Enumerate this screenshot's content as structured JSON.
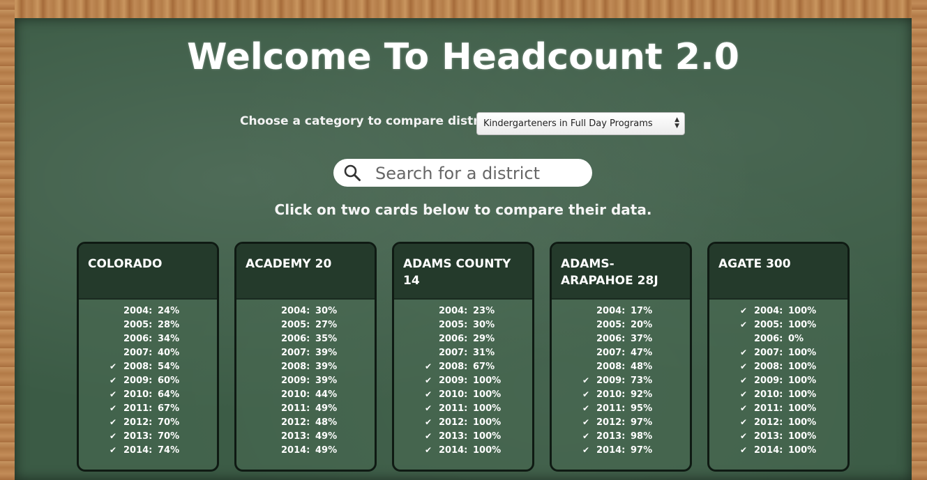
{
  "title": "Welcome To Headcount 2.0",
  "category": {
    "label": "Choose a category to compare districts:",
    "selected": "Kindergarteners in Full Day Programs"
  },
  "search": {
    "placeholder": "Search for a district",
    "icon": "search-icon"
  },
  "instruction": "Click on two cards below to compare their data.",
  "cards": [
    {
      "name": "COLORADO",
      "rows": [
        {
          "year": "2004:",
          "value": "24%",
          "check": false
        },
        {
          "year": "2005:",
          "value": "28%",
          "check": false
        },
        {
          "year": "2006:",
          "value": "34%",
          "check": false
        },
        {
          "year": "2007:",
          "value": "40%",
          "check": false
        },
        {
          "year": "2008:",
          "value": "54%",
          "check": true
        },
        {
          "year": "2009:",
          "value": "60%",
          "check": true
        },
        {
          "year": "2010:",
          "value": "64%",
          "check": true
        },
        {
          "year": "2011:",
          "value": "67%",
          "check": true
        },
        {
          "year": "2012:",
          "value": "70%",
          "check": true
        },
        {
          "year": "2013:",
          "value": "70%",
          "check": true
        },
        {
          "year": "2014:",
          "value": "74%",
          "check": true
        }
      ]
    },
    {
      "name": "ACADEMY 20",
      "rows": [
        {
          "year": "2004:",
          "value": "30%",
          "check": false
        },
        {
          "year": "2005:",
          "value": "27%",
          "check": false
        },
        {
          "year": "2006:",
          "value": "35%",
          "check": false
        },
        {
          "year": "2007:",
          "value": "39%",
          "check": false
        },
        {
          "year": "2008:",
          "value": "39%",
          "check": false
        },
        {
          "year": "2009:",
          "value": "39%",
          "check": false
        },
        {
          "year": "2010:",
          "value": "44%",
          "check": false
        },
        {
          "year": "2011:",
          "value": "49%",
          "check": false
        },
        {
          "year": "2012:",
          "value": "48%",
          "check": false
        },
        {
          "year": "2013:",
          "value": "49%",
          "check": false
        },
        {
          "year": "2014:",
          "value": "49%",
          "check": false
        }
      ]
    },
    {
      "name": "ADAMS COUNTY 14",
      "rows": [
        {
          "year": "2004:",
          "value": "23%",
          "check": false
        },
        {
          "year": "2005:",
          "value": "30%",
          "check": false
        },
        {
          "year": "2006:",
          "value": "29%",
          "check": false
        },
        {
          "year": "2007:",
          "value": "31%",
          "check": false
        },
        {
          "year": "2008:",
          "value": "67%",
          "check": true
        },
        {
          "year": "2009:",
          "value": "100%",
          "check": true
        },
        {
          "year": "2010:",
          "value": "100%",
          "check": true
        },
        {
          "year": "2011:",
          "value": "100%",
          "check": true
        },
        {
          "year": "2012:",
          "value": "100%",
          "check": true
        },
        {
          "year": "2013:",
          "value": "100%",
          "check": true
        },
        {
          "year": "2014:",
          "value": "100%",
          "check": true
        }
      ]
    },
    {
      "name": "ADAMS-ARAPAHOE 28J",
      "rows": [
        {
          "year": "2004:",
          "value": "17%",
          "check": false
        },
        {
          "year": "2005:",
          "value": "20%",
          "check": false
        },
        {
          "year": "2006:",
          "value": "37%",
          "check": false
        },
        {
          "year": "2007:",
          "value": "47%",
          "check": false
        },
        {
          "year": "2008:",
          "value": "48%",
          "check": false
        },
        {
          "year": "2009:",
          "value": "73%",
          "check": true
        },
        {
          "year": "2010:",
          "value": "92%",
          "check": true
        },
        {
          "year": "2011:",
          "value": "95%",
          "check": true
        },
        {
          "year": "2012:",
          "value": "97%",
          "check": true
        },
        {
          "year": "2013:",
          "value": "98%",
          "check": true
        },
        {
          "year": "2014:",
          "value": "97%",
          "check": true
        }
      ]
    },
    {
      "name": "AGATE 300",
      "rows": [
        {
          "year": "2004:",
          "value": "100%",
          "check": true
        },
        {
          "year": "2005:",
          "value": "100%",
          "check": true
        },
        {
          "year": "2006:",
          "value": "0%",
          "check": false
        },
        {
          "year": "2007:",
          "value": "100%",
          "check": true
        },
        {
          "year": "2008:",
          "value": "100%",
          "check": true
        },
        {
          "year": "2009:",
          "value": "100%",
          "check": true
        },
        {
          "year": "2010:",
          "value": "100%",
          "check": true
        },
        {
          "year": "2011:",
          "value": "100%",
          "check": true
        },
        {
          "year": "2012:",
          "value": "100%",
          "check": true
        },
        {
          "year": "2013:",
          "value": "100%",
          "check": true
        },
        {
          "year": "2014:",
          "value": "100%",
          "check": true
        }
      ]
    }
  ]
}
